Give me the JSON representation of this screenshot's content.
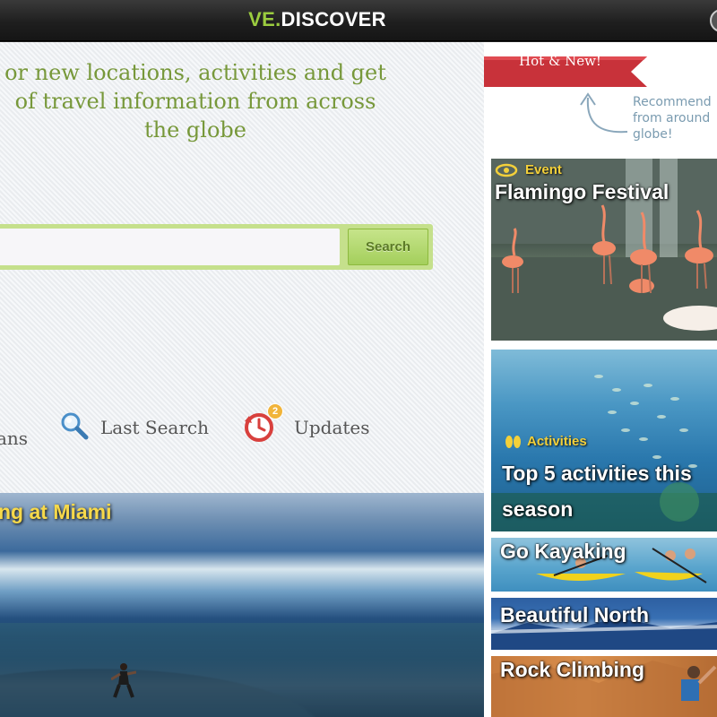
{
  "app": {
    "brand_prefix": "VE.",
    "brand_suffix": "DISCOVER"
  },
  "main": {
    "tagline": "or new locations, activities and get of travel information from across the globe",
    "tagline_lines": [
      "or new locations, activities and get",
      "of travel information from across",
      "the globe"
    ],
    "search": {
      "value": "",
      "placeholder": "",
      "button_label": "Search"
    },
    "nav": {
      "plans_label": "ans",
      "last_search_label": "Last Search",
      "updates_label": "Updates",
      "updates_badge": "2"
    },
    "feature": {
      "title": "ng at Miami"
    }
  },
  "sidebar": {
    "ribbon_label": "Hot & New!",
    "recommend_lines": [
      "Recommend",
      "from around",
      "globe!"
    ],
    "cards": [
      {
        "tag": "Event",
        "title": "Flamingo Festival",
        "tag_icon": "eye-icon"
      },
      {
        "tag": "Activities",
        "title_lines": [
          "Top 5 activities this",
          "season"
        ],
        "tag_icon": "flip-flops-icon"
      },
      {
        "title": "Go Kayaking"
      },
      {
        "title": "Beautiful North"
      },
      {
        "title": "Rock Climbing"
      }
    ]
  },
  "colors": {
    "accent_green": "#9bcc3f",
    "tagline_green": "#77983a",
    "ribbon_red": "#c8323a",
    "tag_yellow": "#f3d03a"
  }
}
